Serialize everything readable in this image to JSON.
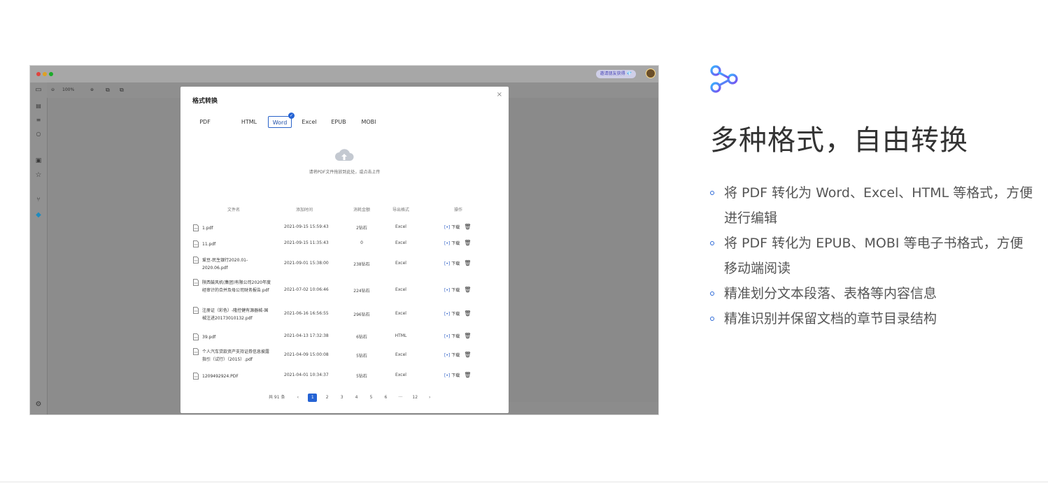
{
  "screenshot": {
    "invite_label": "邀请朋友获得 💎",
    "zoom": "100%",
    "modal": {
      "title": "格式转换",
      "close": "×",
      "source_tab": "PDF",
      "tabs": [
        "HTML",
        "Word",
        "Excel",
        "EPUB",
        "MOBI"
      ],
      "active_tab": "Word",
      "upload_hint": "请将PDF文件拖放到此处，或点击上传",
      "columns": [
        "文件名",
        "添加时间",
        "消耗金额",
        "导出格式",
        "操作"
      ],
      "rows": [
        {
          "name": "1.pdf",
          "time": "2021-09-15 15:59:43",
          "cost": "2钻石",
          "format": "Excel"
        },
        {
          "name": "11.pdf",
          "time": "2021-09-15 11:35:43",
          "cost": "0",
          "format": "Excel"
        },
        {
          "name": "爱豆-民生银行2020.01-2020.06.pdf",
          "time": "2021-09-01 15:38:00",
          "cost": "238钻石",
          "format": "Excel"
        },
        {
          "name": "陕西鼓风机(集团)有限公司2020年度经审计的合并及母公司财务报告.pdf",
          "time": "2021-07-02 10:06:46",
          "cost": "224钻石",
          "format": "Excel"
        },
        {
          "name": "注册证（彩色）-隆控健有源器械-国械注进20173010132.pdf",
          "time": "2021-06-16 16:56:55",
          "cost": "296钻石",
          "format": "Excel"
        },
        {
          "name": "39.pdf",
          "time": "2021-04-13 17:32:38",
          "cost": "6钻石",
          "format": "HTML"
        },
        {
          "name": "个人汽车贷款资产支持证券信息披露指引（试行）（2015）.pdf",
          "time": "2021-04-09 15:00:08",
          "cost": "5钻石",
          "format": "Excel"
        },
        {
          "name": "1209492924.PDF",
          "time": "2021-04-01 10:34:37",
          "cost": "5钻石",
          "format": "Excel"
        }
      ],
      "op_download": "下载",
      "pagination": {
        "total": "共 91 条",
        "prev": "‹",
        "pages": [
          "1",
          "2",
          "3",
          "4",
          "5",
          "6",
          "···",
          "12"
        ],
        "current": "1",
        "next": "›"
      }
    }
  },
  "feature": {
    "icon": "share-node-icon",
    "title": "多种格式，自由转换",
    "bullets": [
      "将 PDF 转化为 Word、Excel、HTML 等格式，方便进行编辑",
      "将 PDF 转化为 EPUB、MOBI 等电子书格式，方便移动端阅读",
      "精准划分文本段落、表格等内容信息",
      "精准识别并保留文档的章节目录结构"
    ],
    "accent": "#2f6bd8"
  }
}
